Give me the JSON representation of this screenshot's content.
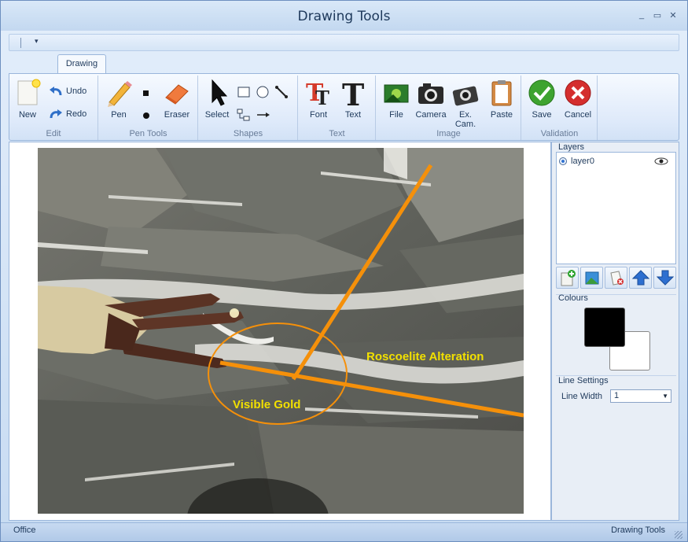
{
  "window": {
    "title": "Drawing Tools",
    "controls": [
      "_",
      "▭",
      "✕"
    ]
  },
  "qat": {
    "dropdown": "▾"
  },
  "tabs": [
    {
      "label": "Drawing"
    }
  ],
  "ribbon": {
    "edit": {
      "label": "Edit",
      "new": "New",
      "undo": "Undo",
      "redo": "Redo"
    },
    "pen_tools": {
      "label": "Pen Tools",
      "pen": "Pen",
      "eraser": "Eraser"
    },
    "shapes": {
      "label": "Shapes",
      "select": "Select"
    },
    "text": {
      "label": "Text",
      "font": "Font",
      "text": "Text"
    },
    "image": {
      "label": "Image",
      "file": "File",
      "camera": "Camera",
      "ex_cam": "Ex. Cam.",
      "paste": "Paste"
    },
    "validation": {
      "label": "Validation",
      "save": "Save",
      "cancel": "Cancel"
    }
  },
  "canvas": {
    "annotations": {
      "label1": "Roscoelite Alteration",
      "label2": "Visible Gold"
    },
    "annotation_color": "#f5900a",
    "label_color": "#f2e000"
  },
  "panel": {
    "layers_title": "Layers",
    "layers": [
      {
        "name": "layer0",
        "selected": true,
        "visible": true
      }
    ],
    "colours_title": "Colours",
    "primary_color": "#000000",
    "secondary_color": "#ffffff",
    "line_settings_title": "Line Settings",
    "line_width_label": "Line Width",
    "line_width_value": "1"
  },
  "status": {
    "left": "Office",
    "right": "Drawing Tools"
  }
}
